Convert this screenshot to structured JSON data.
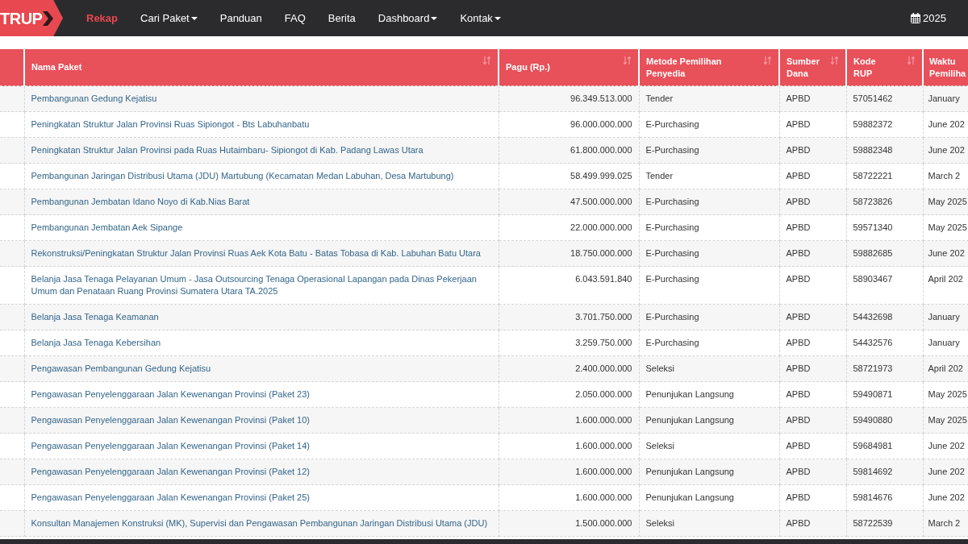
{
  "nav": {
    "logo": "TRUP",
    "items": [
      {
        "label": "Rekap",
        "selected": true,
        "dropdown": false
      },
      {
        "label": "Cari Paket",
        "selected": false,
        "dropdown": true
      },
      {
        "label": "Panduan",
        "selected": false,
        "dropdown": false
      },
      {
        "label": "FAQ",
        "selected": false,
        "dropdown": false
      },
      {
        "label": "Berita",
        "selected": false,
        "dropdown": false
      },
      {
        "label": "Dashboard",
        "selected": false,
        "dropdown": true
      },
      {
        "label": "Kontak",
        "selected": false,
        "dropdown": true
      }
    ],
    "year": "2025"
  },
  "table": {
    "columns": [
      {
        "label": "Nama Paket",
        "kind": "link",
        "sortable": true
      },
      {
        "label": "Pagu (Rp.)",
        "kind": "number",
        "sortable": true
      },
      {
        "label": "Metode Pemilihan Penyedia",
        "kind": "text",
        "sortable": true
      },
      {
        "label": "Sumber Dana",
        "kind": "text",
        "sortable": true
      },
      {
        "label": "Kode RUP",
        "kind": "text",
        "sortable": true
      },
      {
        "label": "Waktu Pemiliha",
        "kind": "text"
      }
    ],
    "rows": [
      {
        "cells": [
          "Pembangunan Gedung Kejatisu",
          "96.349.513.000",
          "Tender",
          "APBD",
          "57051462",
          "January"
        ]
      },
      {
        "cells": [
          "Peningkatan Struktur Jalan Provinsi Ruas Sipiongot - Bts Labuhanbatu",
          "96.000.000.000",
          "E-Purchasing",
          "APBD",
          "59882372",
          "June 202"
        ]
      },
      {
        "cells": [
          "Peningkatan Struktur Jalan Provinsi pada Ruas Hutaimbaru- Sipiongot di Kab. Padang Lawas Utara",
          "61.800.000.000",
          "E-Purchasing",
          "APBD",
          "59882348",
          "June 202"
        ]
      },
      {
        "cells": [
          "Pembangunan Jaringan Distribusi Utama (JDU) Martubung (Kecamatan Medan Labuhan, Desa Martubung)",
          "58.499.999.025",
          "Tender",
          "APBD",
          "58722221",
          "March 2"
        ]
      },
      {
        "cells": [
          "Pembangunan Jembatan Idano Noyo di Kab.Nias Barat",
          "47.500.000.000",
          "E-Purchasing",
          "APBD",
          "58723826",
          "May 2025"
        ]
      },
      {
        "cells": [
          "Pembangunan Jembatan Aek Sipange",
          "22.000.000.000",
          "E-Purchasing",
          "APBD",
          "59571340",
          "May 2025"
        ]
      },
      {
        "cells": [
          "Rekonstruksi/Peningkatan Struktur Jalan Provinsi Ruas Aek Kota Batu - Batas Tobasa di Kab. Labuhan Batu Utara",
          "18.750.000.000",
          "E-Purchasing",
          "APBD",
          "59882685",
          "June 202"
        ]
      },
      {
        "cells": [
          "Belanja Jasa Tenaga Pelayanan Umum - Jasa Outsourcing Tenaga Operasional Lapangan pada Dinas Pekerjaan Umum dan Penataan Ruang Provinsi Sumatera Utara TA.2025",
          "6.043.591.840",
          "E-Purchasing",
          "APBD",
          "58903467",
          "April 202"
        ]
      },
      {
        "cells": [
          "Belanja Jasa Tenaga Keamanan",
          "3.701.750.000",
          "E-Purchasing",
          "APBD",
          "54432698",
          "January"
        ]
      },
      {
        "cells": [
          "Belanja Jasa Tenaga Kebersihan",
          "3.259.750.000",
          "E-Purchasing",
          "APBD",
          "54432576",
          "January"
        ]
      },
      {
        "cells": [
          "Pengawasan Pembangunan Gedung Kejatisu",
          "2.400.000.000",
          "Seleksi",
          "APBD",
          "58721973",
          "April 202"
        ]
      },
      {
        "cells": [
          "Pengawasan Penyelenggaraan Jalan Kewenangan Provinsi (Paket 23)",
          "2.050.000.000",
          "Penunjukan Langsung",
          "APBD",
          "59490871",
          "May 2025"
        ]
      },
      {
        "cells": [
          "Pengawasan Penyelenggaraan Jalan Kewenangan Provinsi (Paket 10)",
          "1.600.000.000",
          "Penunjukan Langsung",
          "APBD",
          "59490880",
          "May 2025"
        ]
      },
      {
        "cells": [
          "Pengawasan Penyelenggaraan Jalan Kewenangan Provinsi (Paket 14)",
          "1.600.000.000",
          "Seleksi",
          "APBD",
          "59684981",
          "June 202"
        ]
      },
      {
        "cells": [
          "Pengawasan Penyelenggaraan Jalan Kewenangan Provinsi (Paket 12)",
          "1.600.000.000",
          "Penunjukan Langsung",
          "APBD",
          "59814692",
          "June 202"
        ]
      },
      {
        "cells": [
          "Pengawasan Penyelenggaraan Jalan Kewenangan Provinsi (Paket 25)",
          "1.600.000.000",
          "Penunjukan Langsung",
          "APBD",
          "59814676",
          "June 202"
        ]
      },
      {
        "cells": [
          "Konsultan Manajemen Konstruksi (MK), Supervisi dan Pengawasan Pembangunan Jaringan Distribusi Utama (JDU)",
          "1.500.000.000",
          "Seleksi",
          "APBD",
          "58722539",
          "March 2"
        ]
      }
    ]
  }
}
